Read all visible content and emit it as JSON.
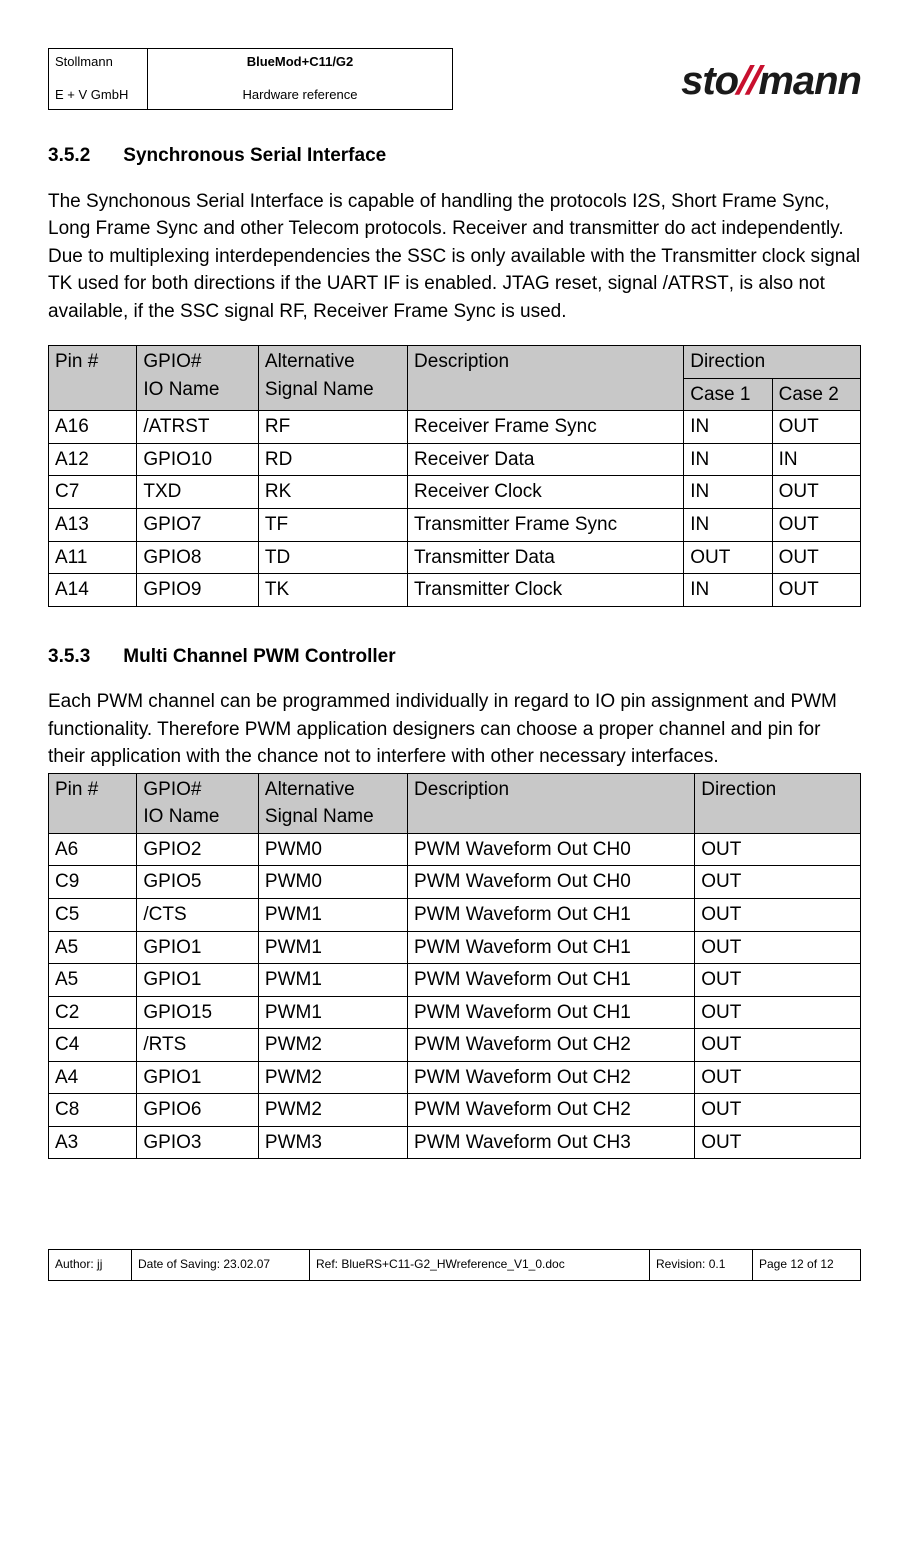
{
  "header": {
    "company": "Stollmann",
    "subsidiary": "E + V GmbH",
    "product": "BlueMod+C11/G2",
    "doc_type": "Hardware reference",
    "logo_pre": "sto",
    "logo_slash": "//",
    "logo_post": "mann"
  },
  "section1": {
    "number": "3.5.2",
    "title": "Synchronous Serial Interface",
    "para1": "The Synchonous Serial Interface is capable of handling the protocols I2S, Short Frame Sync, Long Frame Sync and other Telecom protocols. Receiver and transmitter do act independently. Due to multiplexing interdependencies the SSC is only available with the Transmitter clock signal TK used for both directions if the UART IF is enabled. JTAG reset, signal ",
    "para1_sig": "/ATRST",
    "para1_tail": ", is also not available, if the SSC signal RF, Receiver Frame Sync is used."
  },
  "table1": {
    "headers": {
      "pin": "Pin #",
      "gpio_l1": "GPIO#",
      "gpio_l2": "IO Name",
      "alt_l1": "Alternative",
      "alt_l2": "Signal Name",
      "desc": "Description",
      "dir": "Direction",
      "case1": "Case 1",
      "case2": "Case 2"
    },
    "rows": [
      {
        "pin": "A16",
        "gpio": "/ATRST",
        "alt": "RF",
        "desc": "Receiver Frame Sync",
        "c1": "IN",
        "c2": "OUT"
      },
      {
        "pin": "A12",
        "gpio": "GPIO10",
        "alt": "RD",
        "desc": "Receiver Data",
        "c1": "IN",
        "c2": "IN"
      },
      {
        "pin": "C7",
        "gpio": "TXD",
        "alt": "RK",
        "desc": "Receiver Clock",
        "c1": "IN",
        "c2": "OUT"
      },
      {
        "pin": "A13",
        "gpio": "GPIO7",
        "alt": "TF",
        "desc": "Transmitter Frame Sync",
        "c1": "IN",
        "c2": "OUT"
      },
      {
        "pin": "A11",
        "gpio": "GPIO8",
        "alt": "TD",
        "desc": "Transmitter Data",
        "c1": "OUT",
        "c2": "OUT"
      },
      {
        "pin": "A14",
        "gpio": "GPIO9",
        "alt": "TK",
        "desc": "Transmitter Clock",
        "c1": "IN",
        "c2": "OUT"
      }
    ]
  },
  "section2": {
    "number": "3.5.3",
    "title": "Multi Channel PWM Controller",
    "para": "Each PWM channel can be programmed individually in regard to IO pin assignment and PWM functionality. Therefore PWM application designers can choose a proper channel and pin for their application with the chance not to interfere with other necessary interfaces."
  },
  "table2": {
    "headers": {
      "pin": "Pin #",
      "gpio_l1": "GPIO#",
      "gpio_l2": "IO Name",
      "alt_l1": "Alternative",
      "alt_l2": "Signal Name",
      "desc": "Description",
      "dir": "Direction"
    },
    "rows": [
      {
        "pin": "A6",
        "gpio": "GPIO2",
        "alt": "PWM0",
        "desc": "PWM Waveform Out CH0",
        "dir": "OUT"
      },
      {
        "pin": "C9",
        "gpio": "GPIO5",
        "alt": "PWM0",
        "desc": "PWM Waveform Out CH0",
        "dir": "OUT"
      },
      {
        "pin": "C5",
        "gpio": "/CTS",
        "alt": "PWM1",
        "desc": "PWM Waveform Out CH1",
        "dir": "OUT"
      },
      {
        "pin": "A5",
        "gpio": "GPIO1",
        "alt": "PWM1",
        "desc": "PWM Waveform Out CH1",
        "dir": "OUT"
      },
      {
        "pin": "A5",
        "gpio": "GPIO1",
        "alt": "PWM1",
        "desc": "PWM Waveform Out CH1",
        "dir": "OUT"
      },
      {
        "pin": "C2",
        "gpio": "GPIO15",
        "alt": "PWM1",
        "desc": "PWM Waveform Out CH1",
        "dir": "OUT"
      },
      {
        "pin": "C4",
        "gpio": "/RTS",
        "alt": "PWM2",
        "desc": "PWM Waveform Out CH2",
        "dir": "OUT"
      },
      {
        "pin": "A4",
        "gpio": "GPIO1",
        "alt": "PWM2",
        "desc": "PWM Waveform Out CH2",
        "dir": "OUT"
      },
      {
        "pin": "C8",
        "gpio": "GPIO6",
        "alt": "PWM2",
        "desc": "PWM Waveform Out CH2",
        "dir": "OUT"
      },
      {
        "pin": "A3",
        "gpio": "GPIO3",
        "alt": "PWM3",
        "desc": "PWM Waveform Out CH3",
        "dir": "OUT"
      }
    ]
  },
  "footer": {
    "author": "Author: jj",
    "date": "Date of Saving: 23.02.07",
    "ref": "Ref: BlueRS+C11-G2_HWreference_V1_0.doc",
    "rev": "Revision: 0.1",
    "page": "Page 12 of 12"
  }
}
